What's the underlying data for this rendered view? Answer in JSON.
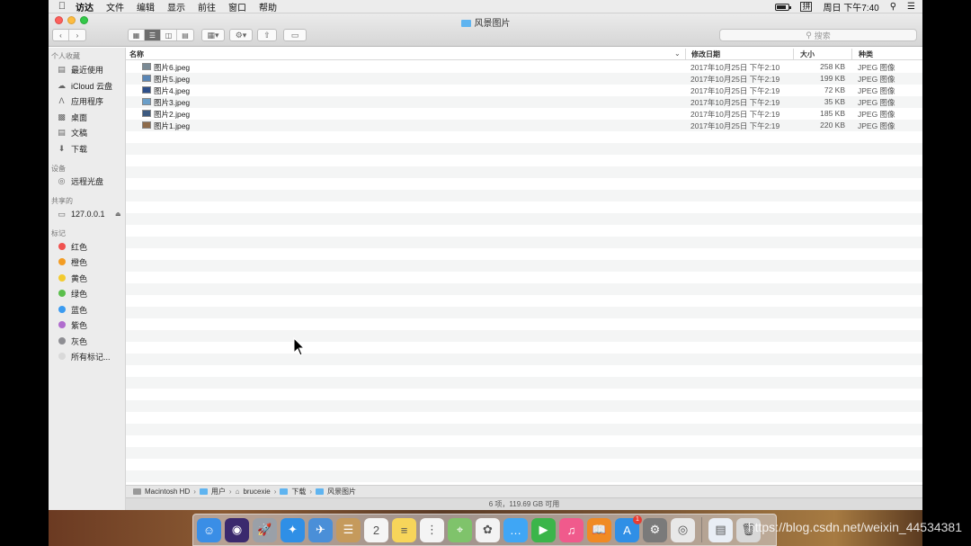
{
  "menubar": {
    "items": [
      "访达",
      "文件",
      "编辑",
      "显示",
      "前往",
      "窗口",
      "帮助"
    ],
    "clock": "周日 下午7:40"
  },
  "window": {
    "title": "风景图片",
    "search_placeholder": "搜索"
  },
  "sidebar": {
    "favorites_header": "个人收藏",
    "favorites": [
      {
        "label": "最近使用",
        "icon": "recents-icon"
      },
      {
        "label": "iCloud 云盘",
        "icon": "cloud-icon"
      },
      {
        "label": "应用程序",
        "icon": "applications-icon"
      },
      {
        "label": "桌面",
        "icon": "desktop-icon"
      },
      {
        "label": "文稿",
        "icon": "documents-icon"
      },
      {
        "label": "下载",
        "icon": "downloads-icon"
      }
    ],
    "devices_header": "设备",
    "devices": [
      {
        "label": "远程光盘",
        "icon": "disc-icon"
      }
    ],
    "shared_header": "共享的",
    "shared": [
      {
        "label": "127.0.0.1",
        "icon": "monitor-icon"
      }
    ],
    "tags_header": "标记",
    "tags": [
      {
        "label": "红色",
        "color": "#f0524f"
      },
      {
        "label": "橙色",
        "color": "#f39c23"
      },
      {
        "label": "黄色",
        "color": "#f3cb2f"
      },
      {
        "label": "绿色",
        "color": "#5bbf4c"
      },
      {
        "label": "蓝色",
        "color": "#3b9bf0"
      },
      {
        "label": "紫色",
        "color": "#b06cce"
      },
      {
        "label": "灰色",
        "color": "#8e8e93"
      },
      {
        "label": "所有标记...",
        "color": "#d9d9d9"
      }
    ]
  },
  "columns": {
    "name": "名称",
    "date": "修改日期",
    "size": "大小",
    "kind": "种类"
  },
  "files": [
    {
      "name": "图片6.jpeg",
      "date": "2017年10月25日 下午2:10",
      "size": "258 KB",
      "kind": "JPEG 图像"
    },
    {
      "name": "图片5.jpeg",
      "date": "2017年10月25日 下午2:19",
      "size": "199 KB",
      "kind": "JPEG 图像"
    },
    {
      "name": "图片4.jpeg",
      "date": "2017年10月25日 下午2:19",
      "size": "72 KB",
      "kind": "JPEG 图像"
    },
    {
      "name": "图片3.jpeg",
      "date": "2017年10月25日 下午2:19",
      "size": "35 KB",
      "kind": "JPEG 图像"
    },
    {
      "name": "图片2.jpeg",
      "date": "2017年10月25日 下午2:19",
      "size": "185 KB",
      "kind": "JPEG 图像"
    },
    {
      "name": "图片1.jpeg",
      "date": "2017年10月25日 下午2:19",
      "size": "220 KB",
      "kind": "JPEG 图像"
    }
  ],
  "pathbar": [
    "Macintosh HD",
    "用户",
    "brucexie",
    "下载",
    "风景图片"
  ],
  "status": "6 项，119.69 GB 可用",
  "dock": {
    "apps": [
      {
        "name": "finder-icon",
        "color": "#3a8ee6",
        "glyph": "☺"
      },
      {
        "name": "siri-icon",
        "color": "#3b2a6e",
        "glyph": "◉"
      },
      {
        "name": "launchpad-icon",
        "color": "#9aa0a8",
        "glyph": "🚀"
      },
      {
        "name": "safari-icon",
        "color": "#2f8fe6",
        "glyph": "✦"
      },
      {
        "name": "mail-icon",
        "color": "#4a8fd8",
        "glyph": "✈"
      },
      {
        "name": "contacts-icon",
        "color": "#c59a5c",
        "glyph": "☰"
      },
      {
        "name": "calendar-icon",
        "color": "#f5f5f5",
        "glyph": "2"
      },
      {
        "name": "notes-icon",
        "color": "#f7d55a",
        "glyph": "≡"
      },
      {
        "name": "reminders-icon",
        "color": "#f4f4f4",
        "glyph": "⋮"
      },
      {
        "name": "maps-icon",
        "color": "#7fc36b",
        "glyph": "⌖"
      },
      {
        "name": "photos-icon",
        "color": "#f3f3f3",
        "glyph": "✿"
      },
      {
        "name": "messages-icon",
        "color": "#3fa6f5",
        "glyph": "…"
      },
      {
        "name": "facetime-icon",
        "color": "#3bb54a",
        "glyph": "▶"
      },
      {
        "name": "itunes-icon",
        "color": "#f05a8c",
        "glyph": "♫"
      },
      {
        "name": "ibooks-icon",
        "color": "#f08a24",
        "glyph": "📖"
      },
      {
        "name": "app-store-icon",
        "color": "#2f8fe6",
        "glyph": "A",
        "badge": "1"
      },
      {
        "name": "system-preferences-icon",
        "color": "#7a7a7a",
        "glyph": "⚙"
      },
      {
        "name": "chrome-icon",
        "color": "#e8e8e8",
        "glyph": "◎"
      }
    ],
    "extras": [
      {
        "name": "downloads-stack-icon",
        "color": "#e9eef5",
        "glyph": "▤"
      },
      {
        "name": "trash-icon",
        "color": "#d8d8d8",
        "glyph": "🗑"
      }
    ]
  },
  "watermark": "https://blog.csdn.net/weixin_44534381"
}
